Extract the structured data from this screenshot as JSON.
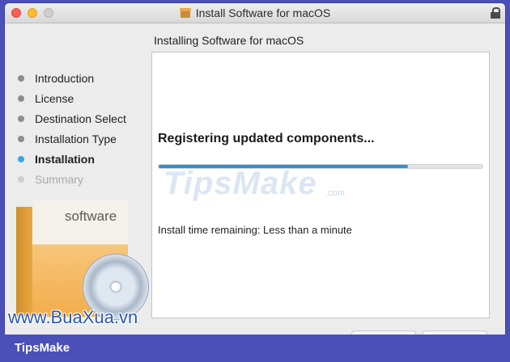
{
  "window": {
    "title": "Install Software for macOS",
    "icon": "package-icon",
    "lock_icon": "lock-icon"
  },
  "header": {
    "subtitle": "Installing Software for macOS"
  },
  "sidebar": {
    "steps": [
      {
        "label": "Introduction",
        "state": "done"
      },
      {
        "label": "License",
        "state": "done"
      },
      {
        "label": "Destination Select",
        "state": "done"
      },
      {
        "label": "Installation Type",
        "state": "done"
      },
      {
        "label": "Installation",
        "state": "active"
      },
      {
        "label": "Summary",
        "state": "pending"
      }
    ]
  },
  "box_art": {
    "label": "software"
  },
  "main": {
    "status": "Registering updated components...",
    "progress_percent": 77,
    "remaining": "Install time remaining: Less than a minute"
  },
  "watermarks": {
    "center": "TipsMake",
    "center_suffix": ".com",
    "site": "www.BuaXua.vn"
  },
  "footer": {
    "brand": "TipsMake"
  },
  "colors": {
    "accent": "#2793dc",
    "active_dot": "#3aa7e0",
    "frame": "#4b4fb8"
  }
}
